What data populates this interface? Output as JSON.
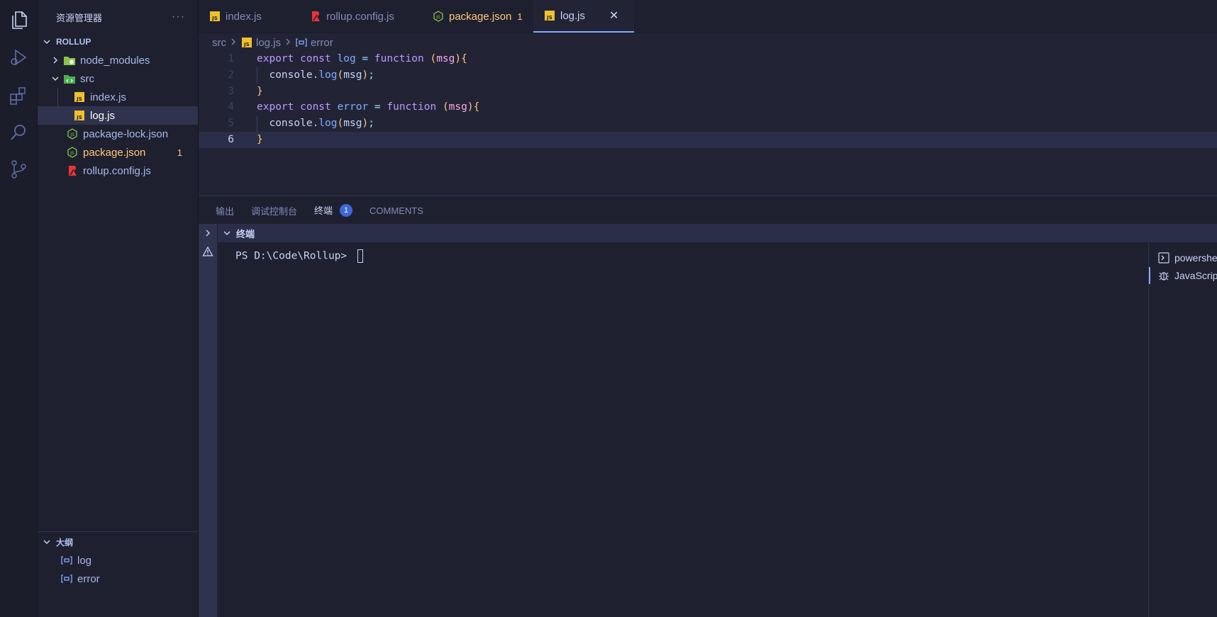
{
  "sidebar": {
    "title": "资源管理器",
    "more": "···",
    "root": "ROLLUP",
    "items": [
      {
        "label": "node_modules"
      },
      {
        "label": "src"
      },
      {
        "label": "index.js"
      },
      {
        "label": "log.js"
      },
      {
        "label": "package-lock.json"
      },
      {
        "label": "package.json",
        "badge": "1"
      },
      {
        "label": "rollup.config.js"
      }
    ],
    "outline": {
      "title": "大纲",
      "items": [
        {
          "label": "log"
        },
        {
          "label": "error"
        }
      ]
    }
  },
  "tabs": [
    {
      "label": "index.js"
    },
    {
      "label": "rollup.config.js"
    },
    {
      "label": "package.json",
      "badge": "1"
    },
    {
      "label": "log.js",
      "close": "✕"
    }
  ],
  "breadcrumb": {
    "folder": "src",
    "file": "log.js",
    "symbol": "error"
  },
  "code": {
    "line_numbers": [
      "1",
      "2",
      "3",
      "4",
      "5",
      "6"
    ],
    "lines": [
      [
        [
          "kw",
          "export "
        ],
        [
          "kw",
          "const "
        ],
        [
          "fn",
          "log "
        ],
        [
          "op",
          "= "
        ],
        [
          "kw",
          "function "
        ],
        [
          "par",
          "("
        ],
        [
          "prm",
          "msg"
        ],
        [
          "par",
          "){"
        ]
      ],
      [
        [
          "var",
          "  console"
        ],
        [
          "op",
          "."
        ],
        [
          "fn",
          "log"
        ],
        [
          "par",
          "("
        ],
        [
          "var",
          "msg"
        ],
        [
          "par",
          ")"
        ],
        [
          "op",
          ";"
        ]
      ],
      [
        [
          "par",
          "}"
        ]
      ],
      [
        [
          "kw",
          "export "
        ],
        [
          "kw",
          "const "
        ],
        [
          "fn",
          "error "
        ],
        [
          "op",
          "= "
        ],
        [
          "kw",
          "function "
        ],
        [
          "par",
          "("
        ],
        [
          "prm",
          "msg"
        ],
        [
          "par",
          "){"
        ]
      ],
      [
        [
          "var",
          "  console"
        ],
        [
          "op",
          "."
        ],
        [
          "fn",
          "log"
        ],
        [
          "par",
          "("
        ],
        [
          "var",
          "msg"
        ],
        [
          "par",
          ")"
        ],
        [
          "op",
          ";"
        ]
      ],
      [
        [
          "par",
          "}"
        ]
      ]
    ]
  },
  "panel": {
    "tabs": [
      {
        "label": "输出"
      },
      {
        "label": "调试控制台"
      },
      {
        "label": "终端",
        "badge": "1"
      },
      {
        "label": "COMMENTS"
      }
    ],
    "terminal_title": "终端",
    "prompt": "PS D:\\Code\\Rollup> ",
    "terminals": [
      {
        "label": "powershell"
      },
      {
        "label": "JavaScript Debug Terminal"
      }
    ]
  },
  "colors": {
    "accent": "#82aaff",
    "modified": "#ffc777",
    "badge": "#3e68d7"
  }
}
